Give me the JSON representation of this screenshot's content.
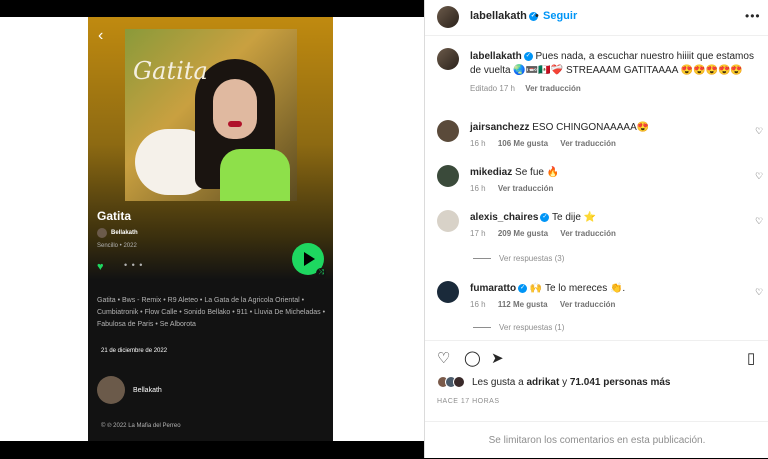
{
  "spotify": {
    "cover_title": "Gatita",
    "song_title": "Gatita",
    "artist": "Bellakath",
    "single_info": "Sencillo • 2022",
    "more": "• • •",
    "tracks": "Gatita • Bws - Remix • R9 Aleteo • La Gata de la Agricola Oriental • Cumbiatronik • Flow Calle • Sonido Bellako • 911 • Lluvia De Micheladas • Fabulosa de Paris • Se Alborota",
    "release_date": "21 de diciembre de 2022",
    "artist_card": "Bellakath",
    "copyright": "© ℗ 2022 La Mafia del Perreo"
  },
  "header": {
    "username": "labellakath",
    "separator": "•",
    "follow": "Seguir",
    "options": "•••"
  },
  "caption": {
    "username": "labellakath",
    "text": "Pues nada, a escuchar nuestro hiiiit que estamos de vuelta 🌏📼🇲🇽❤️‍🩹 STREAAAM GATITAAAA 😍😍😍😍😍",
    "edited": "Editado",
    "time": "17 h",
    "translate": "Ver traducción"
  },
  "comments": [
    {
      "user": "jairsanchezz",
      "text": "ESO CHINGONAAAAA😍",
      "time": "16 h",
      "likes": "106 Me gusta",
      "translate": "Ver traducción",
      "verified": false,
      "avatar_color": "#5a4a3a"
    },
    {
      "user": "mikediaz",
      "text": "Se fue 🔥",
      "time": "16 h",
      "likes": "",
      "translate": "Ver traducción",
      "verified": false,
      "avatar_color": "#3a4a3a"
    },
    {
      "user": "alexis_chaires",
      "text": "Te dije ⭐",
      "time": "17 h",
      "likes": "209 Me gusta",
      "translate": "Ver traducción",
      "verified": true,
      "avatar_color": "#d8d2c8"
    },
    {
      "user": "fumaratto",
      "text": "🙌 Te lo mereces 👏.",
      "time": "16 h",
      "likes": "112 Me gusta",
      "translate": "Ver traducción",
      "verified": true,
      "avatar_color": "#1a2a3a"
    }
  ],
  "replies": [
    "Ver respuestas (3)",
    "Ver respuestas (1)"
  ],
  "likes": {
    "prefix": "Les gusta a",
    "user": "adrikat",
    "middle": "y",
    "count": "71.041 personas más"
  },
  "time_ago": "HACE 17 HORAS",
  "limited": "Se limitaron los comentarios en esta publicación.",
  "colors": {
    "accent": "#0095f6",
    "spotify_green": "#1ed760"
  }
}
